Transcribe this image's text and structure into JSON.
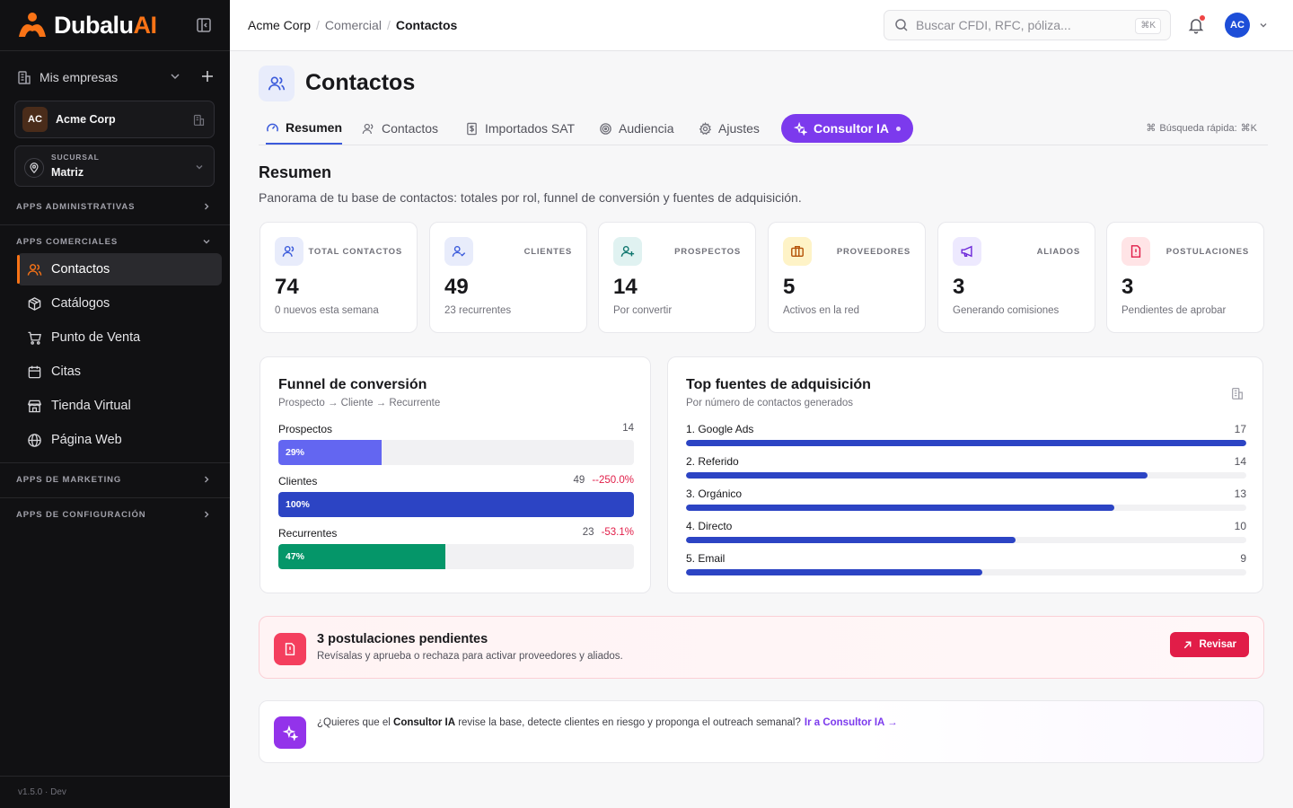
{
  "brand": {
    "name_main": "Dubalu",
    "name_accent": "AI"
  },
  "sidebar": {
    "my_companies_label": "Mis empresas",
    "company": {
      "initials": "AC",
      "name": "Acme Corp"
    },
    "branch": {
      "label": "SUCURSAL",
      "value": "Matriz"
    },
    "sections": {
      "admin": "APPS ADMINISTRATIVAS",
      "commercial": "APPS COMERCIALES",
      "marketing": "APPS DE MARKETING",
      "config": "APPS DE CONFIGURACIÓN"
    },
    "items": [
      {
        "label": "Contactos",
        "icon": "users-icon",
        "active": true
      },
      {
        "label": "Catálogos",
        "icon": "box-icon"
      },
      {
        "label": "Punto de Venta",
        "icon": "cart-icon"
      },
      {
        "label": "Citas",
        "icon": "calendar-icon"
      },
      {
        "label": "Tienda Virtual",
        "icon": "store-icon"
      },
      {
        "label": "Página Web",
        "icon": "globe-icon"
      }
    ],
    "version": "v1.5.0 · Dev"
  },
  "topbar": {
    "breadcrumb": [
      "Acme Corp",
      "Comercial",
      "Contactos"
    ],
    "search_placeholder": "Buscar CFDI, RFC, póliza...",
    "search_shortcut": "⌘K",
    "user_initials": "AC"
  },
  "page": {
    "title": "Contactos",
    "tabs": [
      {
        "label": "Resumen",
        "active": true
      },
      {
        "label": "Contactos"
      },
      {
        "label": "Importados SAT"
      },
      {
        "label": "Audiencia"
      },
      {
        "label": "Ajustes"
      }
    ],
    "ai_tab": "Consultor IA",
    "quick_search_label": "Búsqueda rápida:",
    "quick_search_shortcut": "⌘K",
    "section_title": "Resumen",
    "section_desc": "Panorama de tu base de contactos: totales por rol, funnel de conversión y fuentes de adquisición."
  },
  "colors": {
    "accent": "#f97316",
    "primary": "#2c44c4",
    "violet": "#7c3aed",
    "rose": "#e11d48",
    "green": "#059669"
  },
  "stats": [
    {
      "label": "TOTAL CONTACTOS",
      "value": "74",
      "sub": "0 nuevos esta semana",
      "icon": "users-icon",
      "bg": "#e8ecfb",
      "fg": "#3b5bdb"
    },
    {
      "label": "CLIENTES",
      "value": "49",
      "sub": "23 recurrentes",
      "icon": "user-check-icon",
      "bg": "#e8ecfb",
      "fg": "#3b5bdb"
    },
    {
      "label": "PROSPECTOS",
      "value": "14",
      "sub": "Por convertir",
      "icon": "user-plus-icon",
      "bg": "#e0f2f1",
      "fg": "#0f766e"
    },
    {
      "label": "PROVEEDORES",
      "value": "5",
      "sub": "Activos en la red",
      "icon": "briefcase-icon",
      "bg": "#fef3c7",
      "fg": "#b45309"
    },
    {
      "label": "ALIADOS",
      "value": "3",
      "sub": "Generando comisiones",
      "icon": "megaphone-icon",
      "bg": "#ede9fe",
      "fg": "#6d28d9"
    },
    {
      "label": "POSTULACIONES",
      "value": "3",
      "sub": "Pendientes de aprobar",
      "icon": "file-alert-icon",
      "bg": "#ffe4e6",
      "fg": "#e11d48"
    }
  ],
  "funnel": {
    "title": "Funnel de conversión",
    "subtitle": "Prospecto → Cliente → Recurrente",
    "rows": [
      {
        "label": "Prospectos",
        "count": "14",
        "delta": "",
        "percent": 29,
        "percent_label": "29%",
        "color": "#6366f1"
      },
      {
        "label": "Clientes",
        "count": "49",
        "delta": "--250.0%",
        "percent": 100,
        "percent_label": "100%",
        "color": "#2c44c4"
      },
      {
        "label": "Recurrentes",
        "count": "23",
        "delta": "-53.1%",
        "percent": 47,
        "percent_label": "47%",
        "color": "#059669"
      }
    ]
  },
  "sources": {
    "title": "Top fuentes de adquisición",
    "subtitle": "Por número de contactos generados",
    "max": 17,
    "rows": [
      {
        "label": "1. Google Ads",
        "value": 17
      },
      {
        "label": "2. Referido",
        "value": 14
      },
      {
        "label": "3. Orgánico",
        "value": 13
      },
      {
        "label": "4. Directo",
        "value": 10
      },
      {
        "label": "5. Email",
        "value": 9
      }
    ]
  },
  "alert": {
    "title": "3 postulaciones pendientes",
    "desc": "Revísalas y aprueba o rechaza para activar proveedores y aliados.",
    "button": "Revisar"
  },
  "ai_card": {
    "text_pre": "¿Quieres que el ",
    "text_bold": "Consultor IA",
    "text_post": " revise la base, detecte clientes en riesgo y proponga el outreach semanal?",
    "link": "Ir a Consultor IA →"
  }
}
